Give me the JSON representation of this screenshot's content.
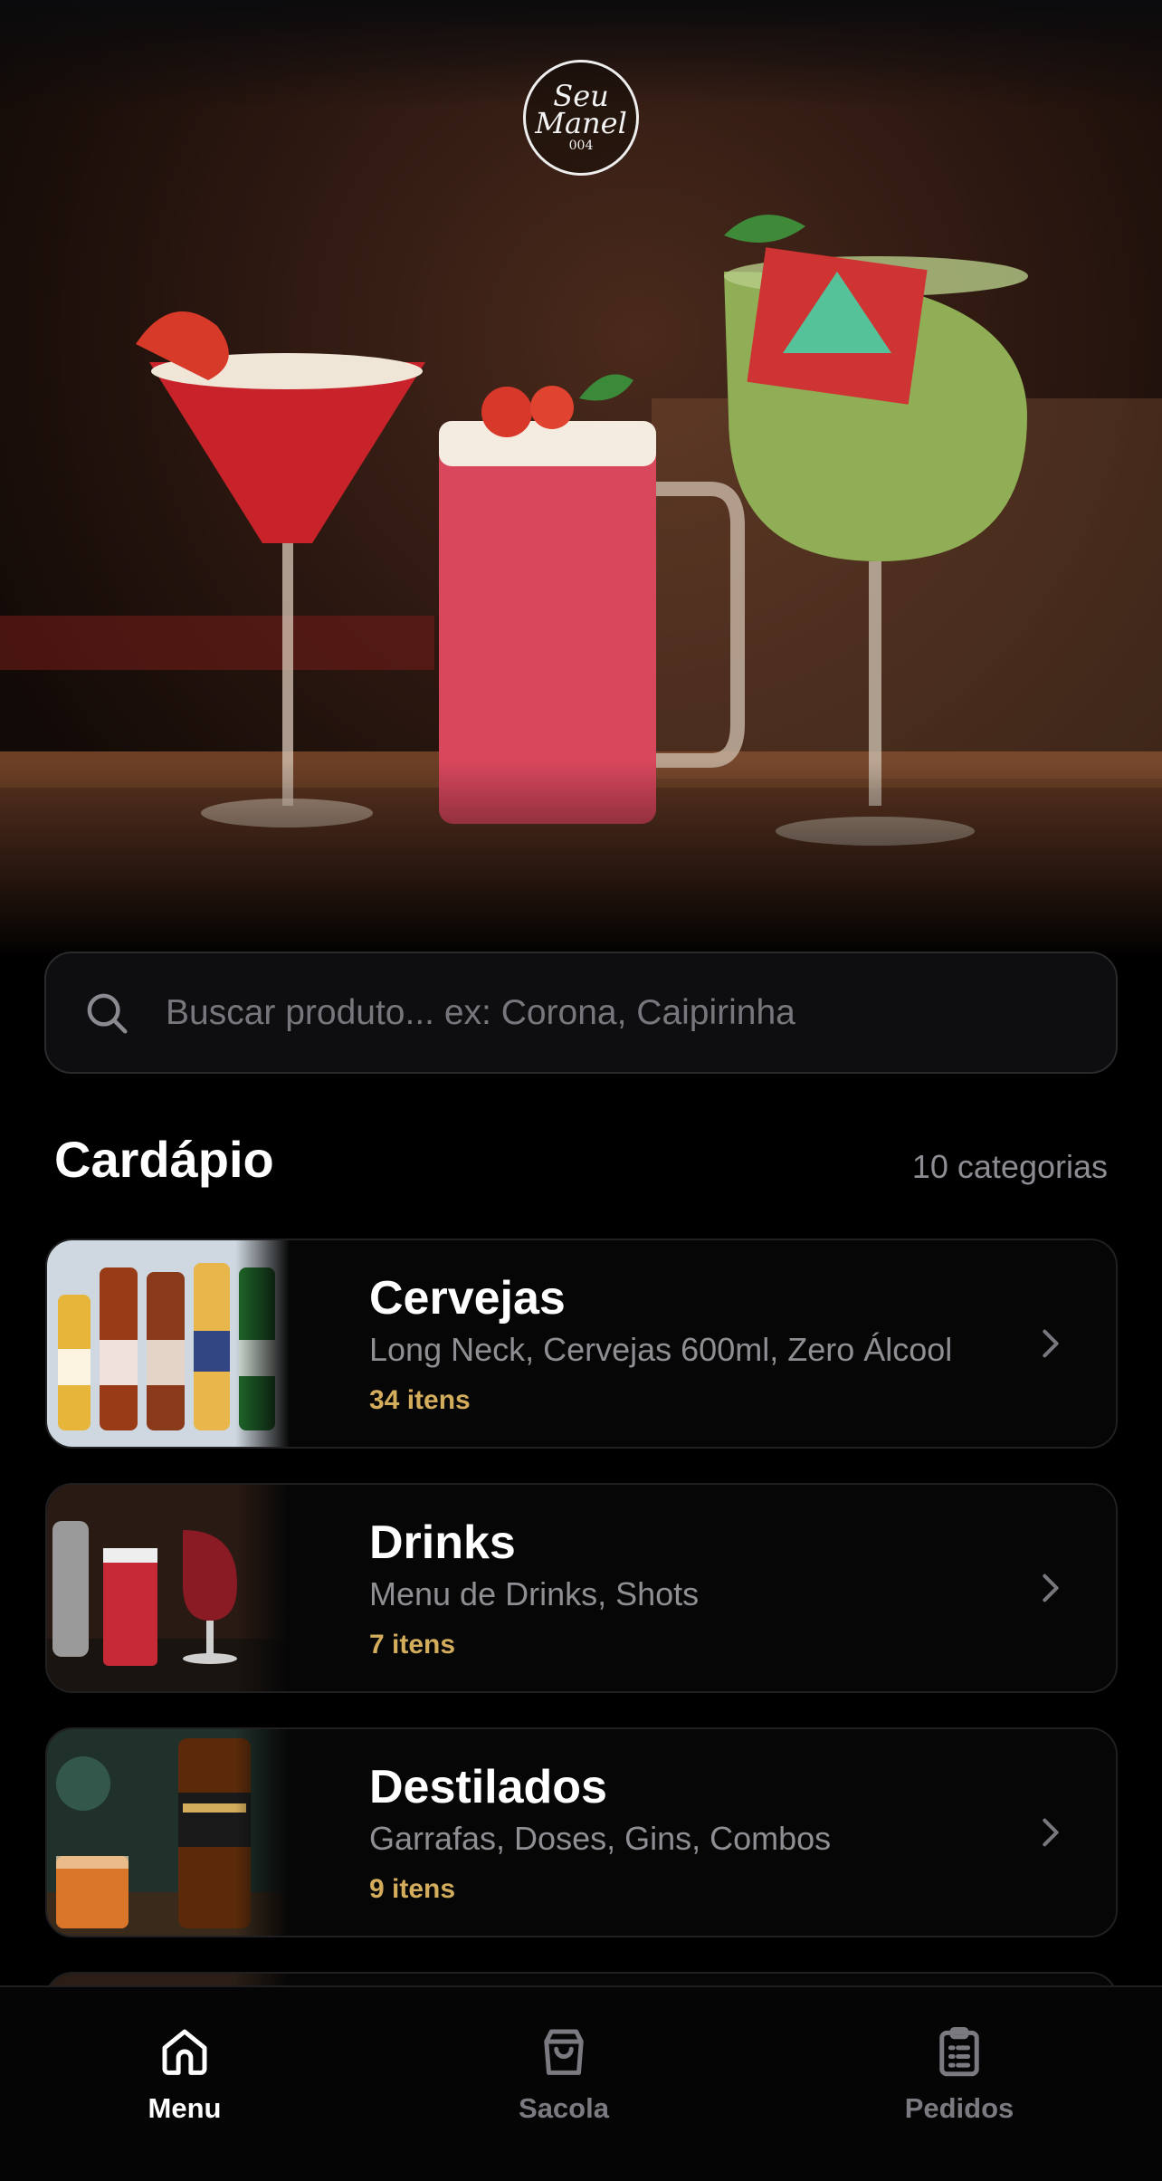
{
  "hero": {
    "logo": {
      "line1": "Seu",
      "line2": "Manel",
      "line3": "004"
    }
  },
  "search": {
    "placeholder": "Buscar produto... ex: Corona, Caipirinha",
    "icon": "search-icon"
  },
  "menu": {
    "title": "Cardápio",
    "count": "10 categorias",
    "categories": [
      {
        "name": "Cervejas",
        "desc": "Long Neck, Cervejas 600ml, Zero Álcool",
        "count": "34 itens"
      },
      {
        "name": "Drinks",
        "desc": "Menu de Drinks, Shots",
        "count": "7 itens"
      },
      {
        "name": "Destilados",
        "desc": "Garrafas, Doses, Gins, Combos",
        "count": "9 itens"
      }
    ]
  },
  "nav": {
    "items": [
      {
        "label": "Menu",
        "icon": "home-icon",
        "active": true
      },
      {
        "label": "Sacola",
        "icon": "shopping-bag-icon",
        "active": false
      },
      {
        "label": "Pedidos",
        "icon": "clipboard-list-icon",
        "active": false
      }
    ]
  },
  "colors": {
    "accent": "#d4ad5c",
    "background": "#000000",
    "muted": "#8e8e93"
  }
}
